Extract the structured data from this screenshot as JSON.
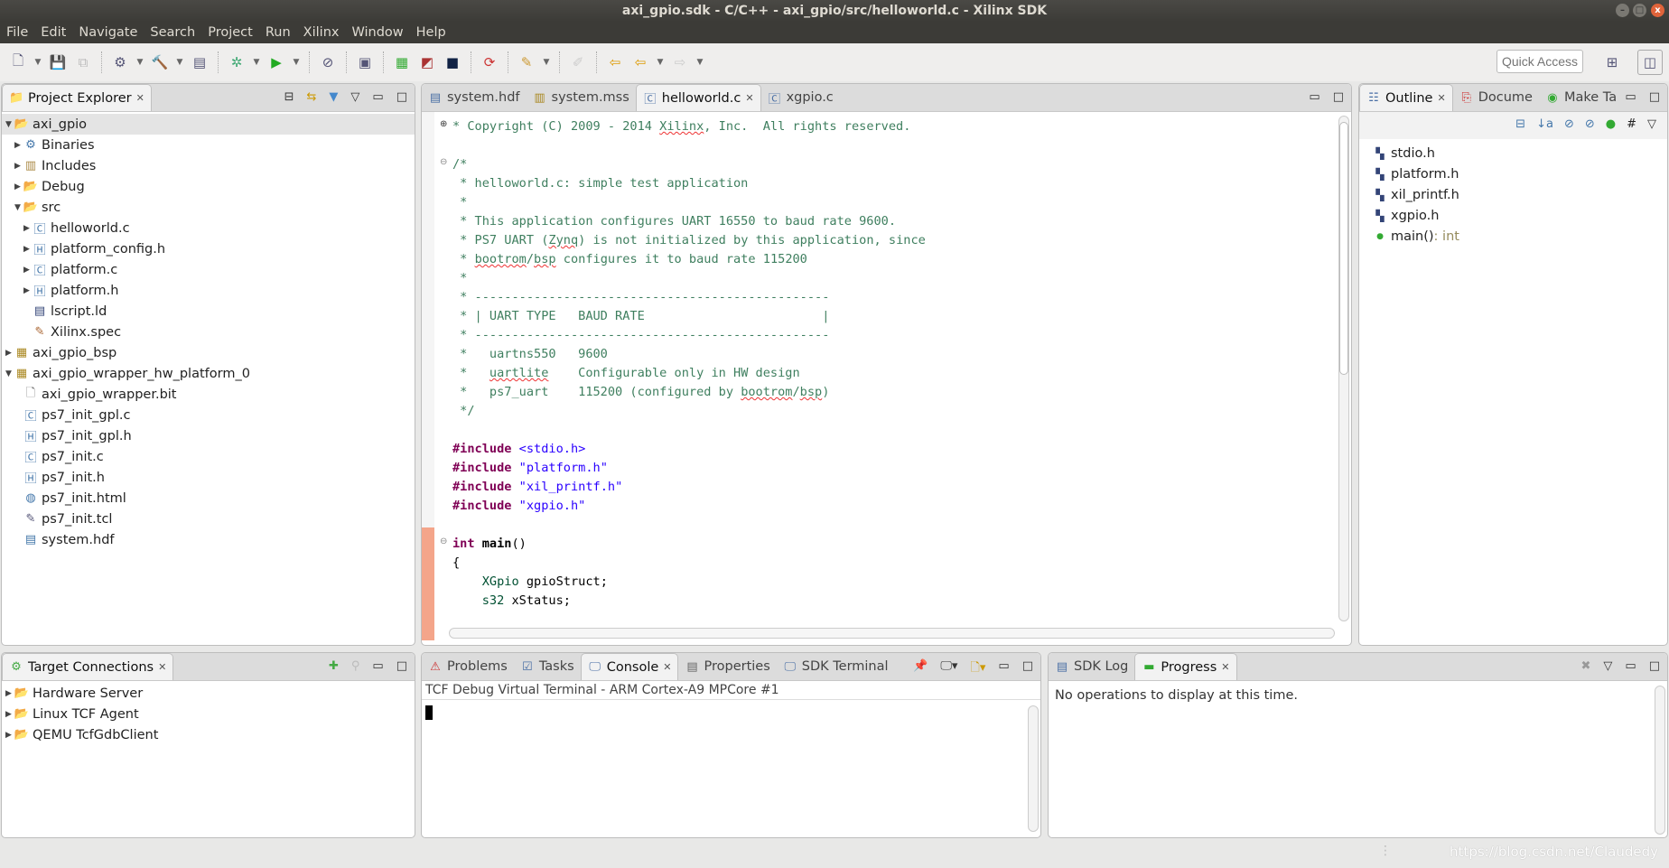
{
  "window": {
    "title": "axi_gpio.sdk - C/C++ - axi_gpio/src/helloworld.c - Xilinx SDK"
  },
  "menu": [
    "File",
    "Edit",
    "Navigate",
    "Search",
    "Project",
    "Run",
    "Xilinx",
    "Window",
    "Help"
  ],
  "toolbar": {
    "quick_access_placeholder": "Quick Access"
  },
  "project_explorer": {
    "title": "Project Explorer",
    "items": [
      {
        "label": "axi_gpio",
        "depth": 0,
        "tw": "▼",
        "icon": "project",
        "sel": true
      },
      {
        "label": "Binaries",
        "depth": 1,
        "tw": "▶",
        "icon": "binaries"
      },
      {
        "label": "Includes",
        "depth": 1,
        "tw": "▶",
        "icon": "includes"
      },
      {
        "label": "Debug",
        "depth": 1,
        "tw": "▶",
        "icon": "folder"
      },
      {
        "label": "src",
        "depth": 1,
        "tw": "▼",
        "icon": "folder"
      },
      {
        "label": "helloworld.c",
        "depth": 2,
        "tw": "▶",
        "icon": "c-file"
      },
      {
        "label": "platform_config.h",
        "depth": 2,
        "tw": "▶",
        "icon": "h-file"
      },
      {
        "label": "platform.c",
        "depth": 2,
        "tw": "▶",
        "icon": "c-file"
      },
      {
        "label": "platform.h",
        "depth": 2,
        "tw": "▶",
        "icon": "h-file"
      },
      {
        "label": "lscript.ld",
        "depth": 2,
        "tw": "",
        "icon": "linker-file"
      },
      {
        "label": "Xilinx.spec",
        "depth": 2,
        "tw": "",
        "icon": "spec-file"
      },
      {
        "label": "axi_gpio_bsp",
        "depth": 0,
        "tw": "▶",
        "icon": "bsp"
      },
      {
        "label": "axi_gpio_wrapper_hw_platform_0",
        "depth": 0,
        "tw": "▼",
        "icon": "hw-platform"
      },
      {
        "label": "axi_gpio_wrapper.bit",
        "depth": 1,
        "tw": "",
        "icon": "file"
      },
      {
        "label": "ps7_init_gpl.c",
        "depth": 1,
        "tw": "",
        "icon": "c-file"
      },
      {
        "label": "ps7_init_gpl.h",
        "depth": 1,
        "tw": "",
        "icon": "h-file"
      },
      {
        "label": "ps7_init.c",
        "depth": 1,
        "tw": "",
        "icon": "c-file"
      },
      {
        "label": "ps7_init.h",
        "depth": 1,
        "tw": "",
        "icon": "h-file"
      },
      {
        "label": "ps7_init.html",
        "depth": 1,
        "tw": "",
        "icon": "html-file"
      },
      {
        "label": "ps7_init.tcl",
        "depth": 1,
        "tw": "",
        "icon": "tcl-file"
      },
      {
        "label": "system.hdf",
        "depth": 1,
        "tw": "",
        "icon": "hdf-file"
      }
    ]
  },
  "editor": {
    "tabs": [
      {
        "label": "system.hdf"
      },
      {
        "label": "system.mss"
      },
      {
        "label": "helloworld.c",
        "active": true
      },
      {
        "label": "xgpio.c"
      }
    ],
    "lines": [
      [
        [
          "* Copyright (C) 2009 - 2014 ",
          ""
        ],
        [
          "Xilinx",
          "sq"
        ],
        [
          ", Inc.  All rights reserved.",
          ""
        ]
      ],
      [],
      [
        [
          "/*",
          ""
        ]
      ],
      [
        [
          " * helloworld.c: simple test application",
          ""
        ]
      ],
      [
        [
          " *",
          ""
        ]
      ],
      [
        [
          " * This application configures UART 16550 to baud rate 9600.",
          ""
        ]
      ],
      [
        [
          " * PS7 UART (",
          ""
        ],
        [
          "Zynq",
          "sq"
        ],
        [
          ") is not initialized by this application, since",
          ""
        ]
      ],
      [
        [
          " * ",
          ""
        ],
        [
          "bootrom",
          "sq"
        ],
        [
          "/",
          ""
        ],
        [
          "bsp",
          "sq"
        ],
        [
          " configures it to baud rate 115200",
          ""
        ]
      ],
      [
        [
          " *",
          ""
        ]
      ],
      [
        [
          " * ------------------------------------------------",
          ""
        ]
      ],
      [
        [
          " * | UART TYPE   BAUD RATE                        |",
          ""
        ]
      ],
      [
        [
          " * ------------------------------------------------",
          ""
        ]
      ],
      [
        [
          " *   uartns550   9600",
          ""
        ]
      ],
      [
        [
          " *   ",
          ""
        ],
        [
          "uartlite",
          "sq"
        ],
        [
          "    Configurable only in HW design",
          ""
        ]
      ],
      [
        [
          " *   ps7_uart    115200 (configured by ",
          ""
        ],
        [
          "bootrom",
          "sq"
        ],
        [
          "/",
          ""
        ],
        [
          "bsp",
          "sq"
        ],
        [
          ")",
          ""
        ]
      ],
      [
        [
          " */",
          ""
        ]
      ],
      [],
      [
        [
          "#include ",
          "kw"
        ],
        [
          "<stdio.h>",
          "str"
        ]
      ],
      [
        [
          "#include ",
          "kw"
        ],
        [
          "\"platform.h\"",
          "str"
        ]
      ],
      [
        [
          "#include ",
          "kw"
        ],
        [
          "\"xil_printf.h\"",
          "str"
        ]
      ],
      [
        [
          "#include ",
          "kw"
        ],
        [
          "\"xgpio.h\"",
          "str"
        ]
      ],
      [],
      [
        [
          "int ",
          "kw"
        ],
        [
          "main",
          "fn"
        ],
        [
          "()",
          "pl"
        ]
      ],
      [
        [
          "{",
          "pl"
        ]
      ],
      [
        [
          "    ",
          ""
        ],
        [
          "XGpio",
          "typ"
        ],
        [
          " gpioStruct;",
          "pl"
        ]
      ],
      [
        [
          "    ",
          ""
        ],
        [
          "s32",
          "typ"
        ],
        [
          " xStatus;",
          "pl"
        ]
      ]
    ]
  },
  "outline": {
    "tabs": [
      {
        "label": "Outline",
        "active": true
      },
      {
        "label": "Docume"
      },
      {
        "label": "Make Ta"
      }
    ],
    "items": [
      {
        "label": "stdio.h",
        "icon": "include"
      },
      {
        "label": "platform.h",
        "icon": "include"
      },
      {
        "label": "xil_printf.h",
        "icon": "include"
      },
      {
        "label": "xgpio.h",
        "icon": "include"
      },
      {
        "label": "main()",
        "type": " : int",
        "icon": "function"
      }
    ]
  },
  "target_connections": {
    "title": "Target Connections",
    "items": [
      "Hardware Server",
      "Linux TCF Agent",
      "QEMU TcfGdbClient"
    ]
  },
  "console": {
    "tabs": [
      {
        "label": "Problems"
      },
      {
        "label": "Tasks"
      },
      {
        "label": "Console",
        "active": true
      },
      {
        "label": "Properties"
      },
      {
        "label": "SDK Terminal"
      }
    ],
    "header": "TCF Debug Virtual Terminal - ARM Cortex-A9 MPCore #1"
  },
  "progress": {
    "tabs": [
      {
        "label": "SDK Log"
      },
      {
        "label": "Progress",
        "active": true
      }
    ],
    "message": "No operations to display at this time."
  },
  "watermark": "https://blog.csdn.net/Claudedy"
}
